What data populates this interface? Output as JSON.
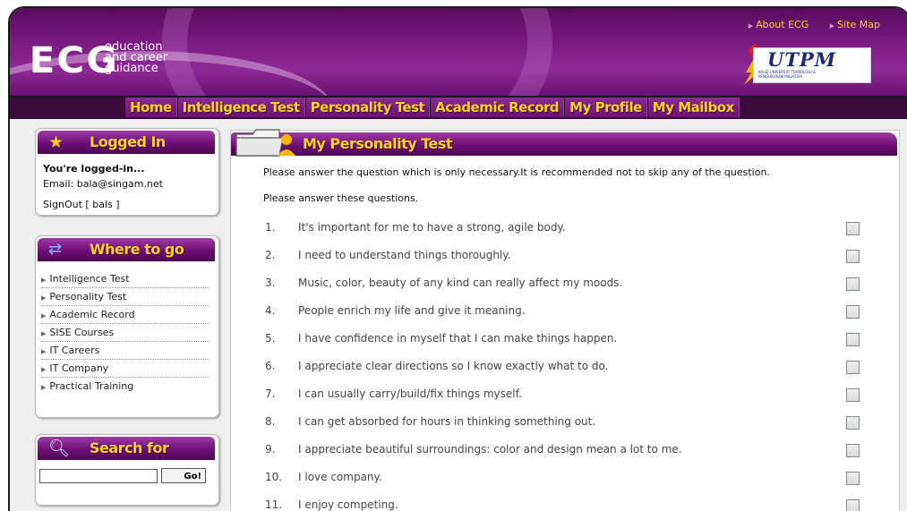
{
  "header": {
    "logo_main": "ECG",
    "logo_sub": [
      "education",
      "and career",
      "guidance"
    ],
    "top_links": [
      "About ECG",
      "Site Map"
    ],
    "partner_logo": "UTPM",
    "partner_small": [
      "KOLEJ UNIVERSITI TEKNOLOGI &",
      "PENGURUSAN MALAYSIA"
    ]
  },
  "nav": [
    "Home",
    "Intelligence Test",
    "Personality Test",
    "Academic Record",
    "My Profile",
    "My Mailbox"
  ],
  "login_box": {
    "title": "Logged In",
    "status": "You're logged-in...",
    "email": "Email: bala@singam.net",
    "signout": "SignOut [ bals ]"
  },
  "where_box": {
    "title": "Where to go",
    "items": [
      "Intelligence Test",
      "Personality Test",
      "Academic Record",
      "SISE Courses",
      "IT Careers",
      "IT Company",
      "Practical Training"
    ]
  },
  "search_box": {
    "title": "Search for",
    "input_value": "",
    "button": "Go!"
  },
  "main": {
    "title": "My Personality Test",
    "intro1": "Please answer the question which is only necessary.It is recommended not to skip any of the question.",
    "intro2": "Please answer these questions.",
    "questions": [
      {
        "num": "1.",
        "text": "It's important for me to have a strong, agile body."
      },
      {
        "num": "2.",
        "text": "I need to understand things thoroughly."
      },
      {
        "num": "3.",
        "text": "Music, color, beauty of any kind can really affect my moods."
      },
      {
        "num": "4.",
        "text": "People enrich my life and give it meaning."
      },
      {
        "num": "5.",
        "text": "I have confidence in myself that I can make things happen."
      },
      {
        "num": "6.",
        "text": "I appreciate clear directions so I know exactly what to do."
      },
      {
        "num": "7.",
        "text": "I can usually carry/build/fix things myself."
      },
      {
        "num": "8.",
        "text": "I can get absorbed for hours in thinking something out."
      },
      {
        "num": "9.",
        "text": "I appreciate beautiful surroundings: color and design mean a lot to me."
      },
      {
        "num": "10.",
        "text": "I love company."
      },
      {
        "num": "11.",
        "text": "I enjoy competing."
      }
    ]
  },
  "colors": {
    "brand_purple": "#7a1a82",
    "nav_text": "#ffd21f"
  }
}
